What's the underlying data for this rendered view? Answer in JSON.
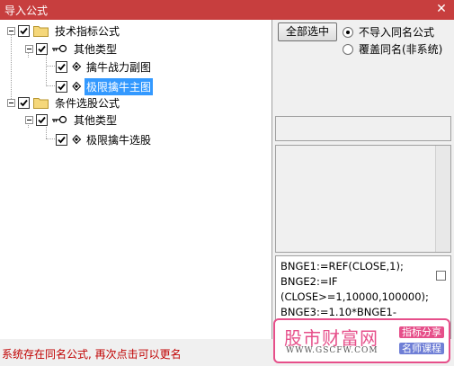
{
  "window": {
    "title": "导入公式",
    "close_glyph": "✕"
  },
  "tree": {
    "n1": "技术指标公式",
    "n2": "其他类型",
    "n3": "擒牛战力副图",
    "n4": "极限擒牛主图",
    "n5": "条件选股公式",
    "n6": "其他类型",
    "n7": "极限擒牛选股"
  },
  "options": {
    "select_all_label": "全部选中",
    "radio_no_import": "不导入同名公式",
    "radio_overwrite": "覆盖同名(非系统)"
  },
  "code_lines": [
    "BNGE1:=REF(CLOSE,1);",
    "BNGE2:=IF",
    "(CLOSE>=1,10000,100000);",
    "BNGE3:=1.10*BNGE1-"
  ],
  "status": "系统存在同名公式, 再次点击可以更名",
  "watermark": {
    "name": "股市财富网",
    "url": "WWW.GSCFW.COM",
    "tag1": "指标分享",
    "tag2": "名师课程"
  },
  "colors": {
    "titlebar": "#c73e3e",
    "selection": "#3399ff",
    "status": "#c00000",
    "watermark": "#e64f8a"
  }
}
